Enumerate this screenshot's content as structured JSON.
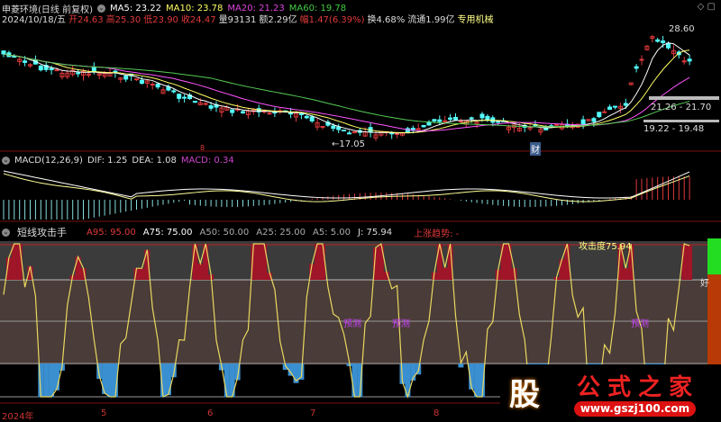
{
  "header": {
    "stock": "申菱环境(日线 前复权)",
    "ma5": "MA5: 23.22",
    "ma10": "MA10: 23.78",
    "ma20": "MA20: 21.23",
    "ma60": "MA60: 19.78",
    "date": "2024/10/18/五",
    "open": "开24.63",
    "high": "高25.30",
    "low": "低23.90",
    "close": "收24.47",
    "volume": "量93131",
    "amount": "额2.29亿",
    "change": "幅1.47(6.39%)",
    "turnover": "换4.68%",
    "float": "流通1.99亿",
    "industry": "专用机械"
  },
  "main": {
    "high_label": "28.60",
    "low_label": "←17.05",
    "zone1": "21.26 - 21.70",
    "zone2": "19.22 - 19.48",
    "marker_cai": "财",
    "marker_r": "8"
  },
  "macd": {
    "title": "MACD(12,26,9)",
    "dif": "DIF: 1.25",
    "dea": "DEA: 1.08",
    "macd": "MACD: 0.34"
  },
  "indicator": {
    "title": "短线攻击手",
    "a95": "A95: 95.00",
    "a75": "A75: 75.00",
    "a50": "A50: 50.00",
    "a25": "A25: 25.00",
    "a5": "A5: 5.00",
    "j": "J: 75.94",
    "trend": "上涨趋势: -",
    "attack": "攻击度75.94",
    "signal": "预测",
    "right_mark": "好"
  },
  "axis": {
    "labels": [
      "2024年",
      "5",
      "6",
      "7",
      "8"
    ]
  },
  "watermark": {
    "name": "公式之家",
    "url": "www.gszj100.com",
    "logo": "股"
  },
  "colors": {
    "up": "#e0393b",
    "down": "#54ffff",
    "ma5": "#ffffff",
    "ma10": "#ffff66",
    "ma20": "#ff55ff",
    "ma60": "#55cc55"
  }
}
